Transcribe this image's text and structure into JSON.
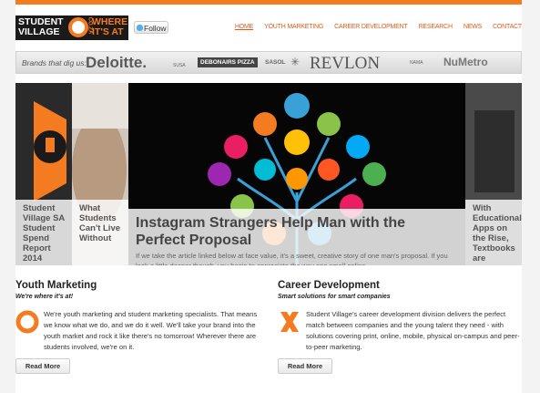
{
  "header": {
    "logo_line1": "STUDENT",
    "logo_line2": "VILLAGE",
    "logo_right1": "WHERE",
    "logo_right2": "IT'S AT",
    "logo_coza": "CO.ZA",
    "follow_label": "Follow"
  },
  "nav": [
    {
      "label": "HOME",
      "active": true
    },
    {
      "label": "YOUTH MARKETING",
      "active": false
    },
    {
      "label": "CAREER DEVELOPMENT",
      "active": false
    },
    {
      "label": "RESEARCH",
      "active": false
    },
    {
      "label": "NEWS",
      "active": false
    },
    {
      "label": "CONTACT",
      "active": false
    }
  ],
  "brands": {
    "label": "Brands that dig us:",
    "items": [
      "Deloitte.",
      "SUSA",
      "DEBONAIRS PIZZA",
      "SASOL",
      "REVLON",
      "NAMA",
      "NuMetro"
    ]
  },
  "slider": {
    "left_caption": "Student Village SA Student Spend Report 2014",
    "second_caption": "What Students Can't Live Without",
    "main_title": "Instagram Strangers Help Man with the Perfect Proposal",
    "main_desc": "If we take the article linked below at face value, it's a sweet, creative story of one man's proposal. If you look a little deeper though, you begin to appreciate the way one small online",
    "right_caption": "With Educational Apps on the Rise, Textbooks are"
  },
  "youth": {
    "title": "Youth Marketing",
    "subtitle": "We're where it's at!",
    "body": "We're youth marketing and student marketing specialists. That means we know what we do, and we do it well. We'll take your brand into the youth market and rock it like there's no tomorrow! Wherever there are students involved, we're on it.",
    "button": "Read More"
  },
  "career": {
    "title": "Career Development",
    "subtitle": "Smart solutions for smart companies",
    "body": "Student Village's career development division delivers the perfect match between companies and the young talent they need - with solutions covering print, online, mobile, physical on-campus and peer-to-peer marketing.",
    "button": "Read More"
  },
  "colors": {
    "accent": "#f47b20",
    "nav": "#e25a1b"
  }
}
